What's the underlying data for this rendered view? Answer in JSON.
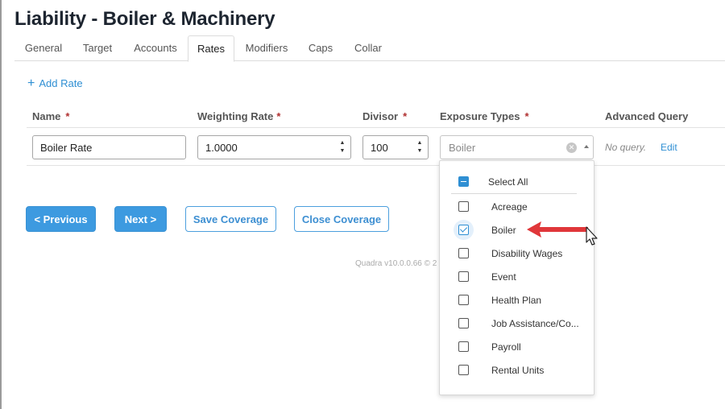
{
  "page": {
    "title": "Liability - Boiler & Machinery"
  },
  "tabs": [
    "General",
    "Target",
    "Accounts",
    "Rates",
    "Modifiers",
    "Caps",
    "Collar"
  ],
  "active_tab": "Rates",
  "add_rate": {
    "label": "Add Rate",
    "icon": "plus-icon"
  },
  "columns": {
    "name": "Name",
    "weighting_rate": "Weighting Rate",
    "divisor": "Divisor",
    "exposure_types": "Exposure Types",
    "advanced_query": "Advanced Query",
    "required_marker": "*"
  },
  "row": {
    "name": "Boiler Rate",
    "weighting_rate": "1.0000",
    "divisor": "100",
    "exposure_types": "Boiler",
    "advanced_query": "No query.",
    "edit_label": "Edit"
  },
  "buttons": {
    "previous": "< Previous",
    "next": "Next >",
    "save_coverage": "Save Coverage",
    "close_coverage": "Close Coverage"
  },
  "footer": {
    "version": "Quadra v10.0.0.66 © 2"
  },
  "dropdown": {
    "select_all": "Select All",
    "options": [
      {
        "label": "Acreage",
        "checked": false
      },
      {
        "label": "Boiler",
        "checked": true
      },
      {
        "label": "Disability Wages",
        "checked": false
      },
      {
        "label": "Event",
        "checked": false
      },
      {
        "label": "Health Plan",
        "checked": false
      },
      {
        "label": "Job Assistance/Co...",
        "checked": false
      },
      {
        "label": "Payroll",
        "checked": false
      },
      {
        "label": "Rental Units",
        "checked": false
      }
    ]
  },
  "colors": {
    "accent": "#3d9ae0",
    "link": "#2f8fd3",
    "annotation_arrow": "#e0373a",
    "required": "#b03030"
  }
}
